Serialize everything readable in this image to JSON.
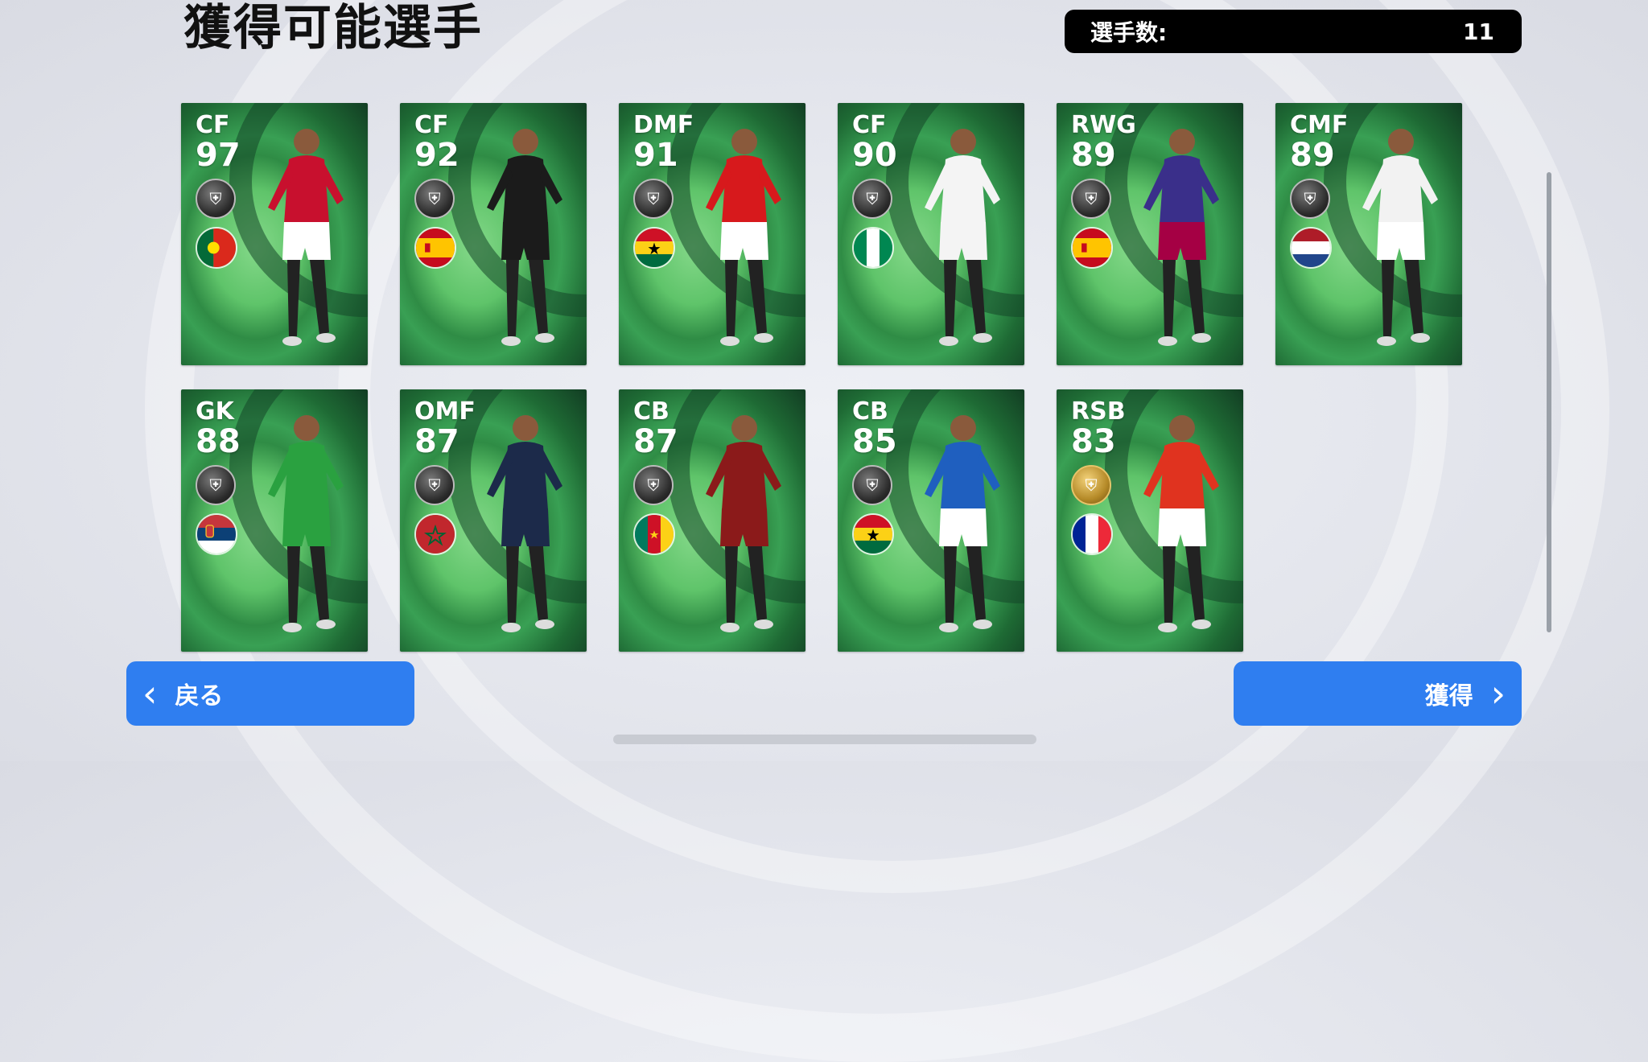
{
  "title": "獲得可能選手",
  "count": {
    "label": "選手数:",
    "value": "11"
  },
  "players": [
    {
      "position": "CF",
      "rating": "97",
      "badge": "black-shield-icon",
      "flag": "portugal-flag-icon",
      "kit": "#c8102e",
      "shorts": "#ffffff"
    },
    {
      "position": "CF",
      "rating": "92",
      "badge": "black-shield-icon",
      "flag": "spain-flag-icon",
      "kit": "#1b1b1b",
      "shorts": "#1b1b1b"
    },
    {
      "position": "DMF",
      "rating": "91",
      "badge": "black-shield-icon",
      "flag": "ghana-flag-icon",
      "kit": "#d7191c",
      "shorts": "#ffffff"
    },
    {
      "position": "CF",
      "rating": "90",
      "badge": "black-shield-icon",
      "flag": "nigeria-flag-icon",
      "kit": "#f4f4f4",
      "shorts": "#f4f4f4"
    },
    {
      "position": "RWG",
      "rating": "89",
      "badge": "black-shield-icon",
      "flag": "spain-flag-icon",
      "kit": "#3a2f8a",
      "shorts": "#a50044"
    },
    {
      "position": "CMF",
      "rating": "89",
      "badge": "black-shield-icon",
      "flag": "netherlands-flag-icon",
      "kit": "#f2f2f2",
      "shorts": "#ffffff"
    },
    {
      "position": "GK",
      "rating": "88",
      "badge": "black-shield-icon",
      "flag": "serbia-flag-icon",
      "kit": "#2aa140",
      "shorts": "#2aa140"
    },
    {
      "position": "OMF",
      "rating": "87",
      "badge": "black-shield-icon",
      "flag": "morocco-flag-icon",
      "kit": "#1c2a4a",
      "shorts": "#1c2a4a"
    },
    {
      "position": "CB",
      "rating": "87",
      "badge": "black-shield-icon",
      "flag": "cameroon-flag-icon",
      "kit": "#8b1a1a",
      "shorts": "#8b1a1a"
    },
    {
      "position": "CB",
      "rating": "85",
      "badge": "black-shield-icon",
      "flag": "ghana-flag-icon",
      "kit": "#1f5fbf",
      "shorts": "#ffffff"
    },
    {
      "position": "RSB",
      "rating": "83",
      "badge": "gold-shield-icon",
      "flag": "france-flag-icon",
      "kit": "#e0331f",
      "shorts": "#ffffff"
    }
  ],
  "buttons": {
    "back": "戻る",
    "acquire": "獲得"
  }
}
